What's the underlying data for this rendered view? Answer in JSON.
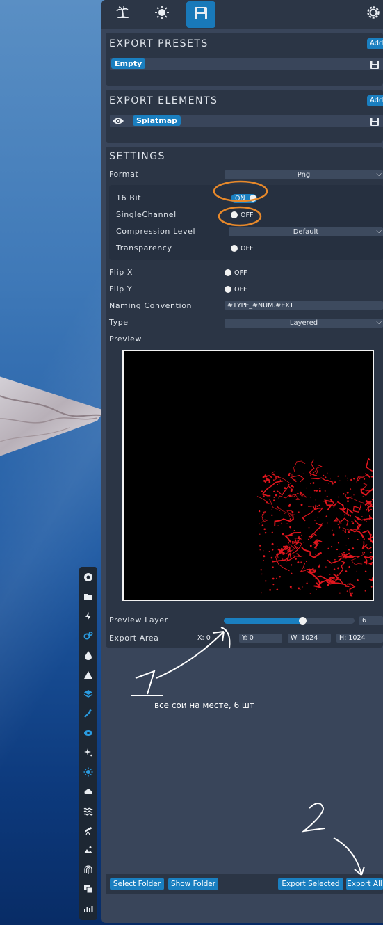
{
  "toolbar": {
    "tabs": [
      {
        "icon": "island-icon",
        "active": false
      },
      {
        "icon": "sun-icon",
        "active": false
      },
      {
        "icon": "floppy-disk-icon",
        "active": true
      }
    ],
    "settings_icon": "gear-icon"
  },
  "presets": {
    "title": "EXPORT PRESETS",
    "add_label": "Add",
    "items": [
      "Empty"
    ]
  },
  "elements": {
    "title": "EXPORT ELEMENTS",
    "add_label": "Add",
    "items": [
      "Splatmap"
    ]
  },
  "settings": {
    "title": "SETTINGS",
    "format_label": "Format",
    "format_value": "Png",
    "bit16_label": "16 Bit",
    "bit16_value": "ON",
    "single_channel_label": "SingleChannel",
    "single_channel_value": "OFF",
    "compression_label": "Compression Level",
    "compression_value": "Default",
    "transparency_label": "Transparency",
    "transparency_value": "OFF",
    "flipx_label": "Flip X",
    "flipx_value": "OFF",
    "flipy_label": "Flip Y",
    "flipy_value": "OFF",
    "naming_label": "Naming Convention",
    "naming_value": "#TYPE_#NUM.#EXT",
    "type_label": "Type",
    "type_value": "Layered",
    "preview_label": "Preview",
    "preview_layer_label": "Preview Layer",
    "preview_layer_value": "6",
    "preview_layer_fraction": 0.6,
    "export_area_label": "Export Area",
    "x_label": "X: 0",
    "y_label": "Y: 0",
    "w_label": "W: 1024",
    "h_label": "H: 1024"
  },
  "footer": {
    "select_folder": "Select Folder",
    "show_folder": "Show Folder",
    "export_selected": "Export Selected",
    "export_all": "Export All"
  },
  "annotations": {
    "note_text": "все сои на месте, 6 шт",
    "colors": {
      "highlight": "#e8892a",
      "arrow": "#ffffff"
    }
  },
  "colors": {
    "accent": "#1a7fc0",
    "panel_bg": "#39455a",
    "section_bg": "#2b3545",
    "splat_red": "#e0161e"
  }
}
